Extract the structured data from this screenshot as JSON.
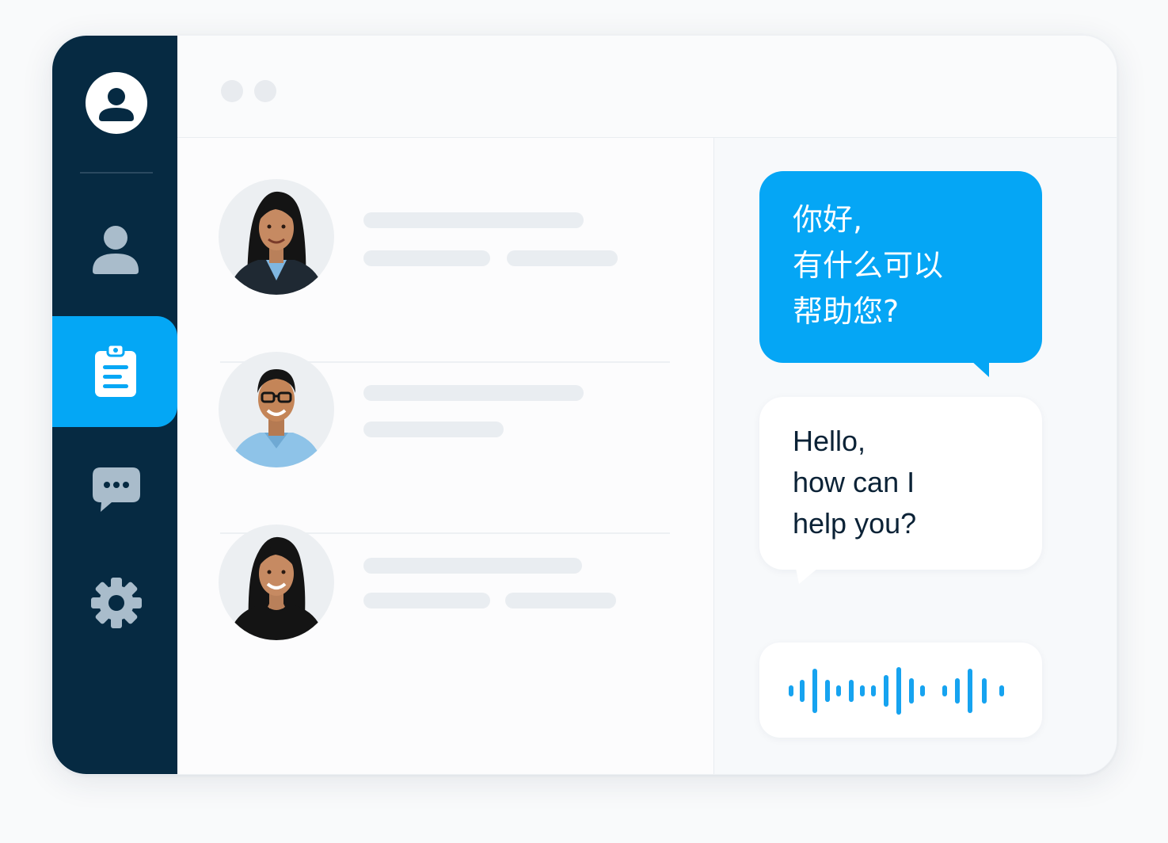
{
  "app": {
    "accent_color": "#04a7f5",
    "sidebar_color": "#062a42",
    "icon_muted_color": "#a9bccb"
  },
  "sidebar": {
    "profile_icon": "account-circle-icon",
    "items": [
      {
        "icon": "person-icon",
        "active": false
      },
      {
        "icon": "clipboard-icon",
        "active": true
      },
      {
        "icon": "chat-bubble-icon",
        "active": false
      },
      {
        "icon": "gear-icon",
        "active": false
      }
    ]
  },
  "contacts": [
    {
      "avatar": "woman-portrait-1",
      "placeholder_lines": 2
    },
    {
      "avatar": "man-portrait-glasses",
      "placeholder_lines": 2
    },
    {
      "avatar": "woman-portrait-2",
      "placeholder_lines": 2
    }
  ],
  "chat": {
    "incoming_message": "你好,\n有什么可以\n帮助您?",
    "translated_message": "Hello,\nhow can I\nhelp you?",
    "voice_icon": "audio-waveform-icon"
  }
}
